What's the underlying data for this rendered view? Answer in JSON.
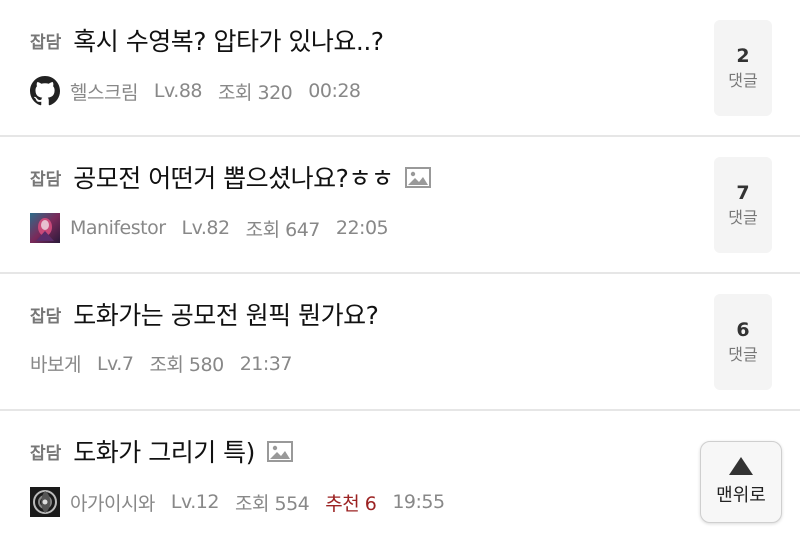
{
  "posts": [
    {
      "category": "잡담",
      "title": "혹시 수영복? 압타가 있나요..?",
      "has_image": false,
      "avatar_icon": "github-icon",
      "author": "헬스크림",
      "level": "Lv.88",
      "views": "조회 320",
      "time": "00:28",
      "comment_count": "2",
      "comment_label": "댓글"
    },
    {
      "category": "잡담",
      "title": "공모전 어떤거 뽑으셨나요?ㅎㅎ",
      "has_image": true,
      "avatar_icon": "game-character-avatar",
      "author": "Manifestor",
      "level": "Lv.82",
      "views": "조회 647",
      "time": "22:05",
      "comment_count": "7",
      "comment_label": "댓글"
    },
    {
      "category": "잡담",
      "title": "도화가는 공모전 원픽 뭔가요?",
      "has_image": false,
      "author": "바보게",
      "level": "Lv.7",
      "views": "조회 580",
      "time": "21:37",
      "comment_count": "6",
      "comment_label": "댓글"
    },
    {
      "category": "잡담",
      "title": "도화가 그리기 특)",
      "has_image": true,
      "avatar_icon": "dark-emblem-avatar",
      "author": "아가이시와",
      "level": "Lv.12",
      "views": "조회 554",
      "recommend": "추천 6",
      "time": "19:55"
    }
  ],
  "scroll_top": {
    "label": "맨위로",
    "icon": "up-triangle-icon"
  },
  "colors": {
    "recommend": "#9b2222",
    "meta": "#888888",
    "divider": "#e6e6e6"
  }
}
